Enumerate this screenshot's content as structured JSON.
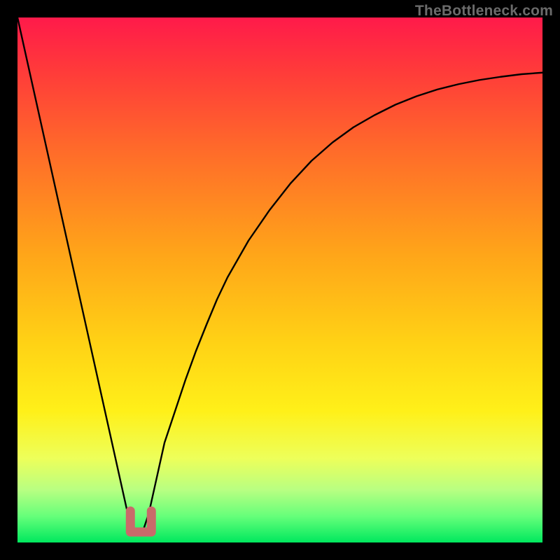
{
  "watermark": "TheBottleneck.com",
  "chart_data": {
    "type": "line",
    "title": "",
    "xlabel": "",
    "ylabel": "",
    "xlim": [
      0,
      100
    ],
    "ylim": [
      0,
      100
    ],
    "x": [
      0,
      2,
      4,
      6,
      8,
      10,
      12,
      14,
      16,
      18,
      19,
      20,
      21,
      22,
      23,
      24,
      25,
      26,
      27,
      28,
      30,
      32,
      34,
      36,
      38,
      40,
      44,
      48,
      52,
      56,
      60,
      64,
      68,
      72,
      76,
      80,
      84,
      88,
      92,
      96,
      100
    ],
    "series": [
      {
        "name": "bottleneck-curve",
        "values": [
          100,
          91,
          82,
          73,
          64,
          55,
          46,
          37,
          28,
          19,
          14.5,
          10,
          5.5,
          2.5,
          2.2,
          2.5,
          5.5,
          10,
          14.5,
          19,
          25,
          31,
          36.5,
          41.5,
          46.3,
          50.5,
          57.5,
          63.3,
          68.4,
          72.7,
          76.2,
          79.1,
          81.4,
          83.4,
          85,
          86.3,
          87.3,
          88.1,
          88.7,
          89.2,
          89.5
        ]
      }
    ],
    "marker": {
      "name": "optimal-region",
      "color": "#c96a6a",
      "x_range": [
        21.5,
        25.5
      ],
      "y_range": [
        2,
        6
      ]
    },
    "background": "heat-gradient-red-to-green"
  }
}
